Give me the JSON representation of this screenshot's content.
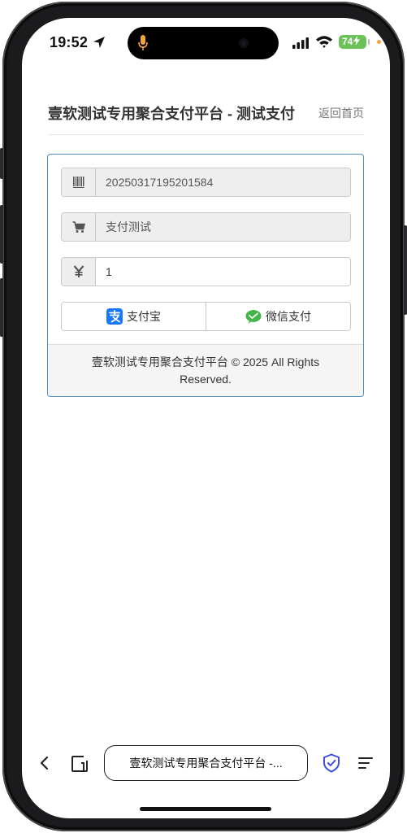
{
  "status_bar": {
    "time": "19:52",
    "battery_level": "74"
  },
  "header": {
    "title": "壹软测试专用聚合支付平台 - 测试支付",
    "home_link": "返回首页"
  },
  "form": {
    "order_number": "20250317195201584",
    "product_name": "支付测试",
    "amount": "1",
    "icons": {
      "order": "barcode-icon",
      "product": "cart-icon",
      "amount": "yen-icon"
    }
  },
  "payment": {
    "alipay_label": "支付宝",
    "wechat_label": "微信支付",
    "alipay_color": "#1677ff",
    "wechat_color": "#44b549"
  },
  "footer": {
    "copyright": "壹软测试专用聚合支付平台 © 2025 All Rights Reserved."
  },
  "browser": {
    "url_title": "壹软测试专用聚合支付平台 -..."
  },
  "colors": {
    "panel_border": "#4f8fc0",
    "battery": "#6ac259"
  }
}
